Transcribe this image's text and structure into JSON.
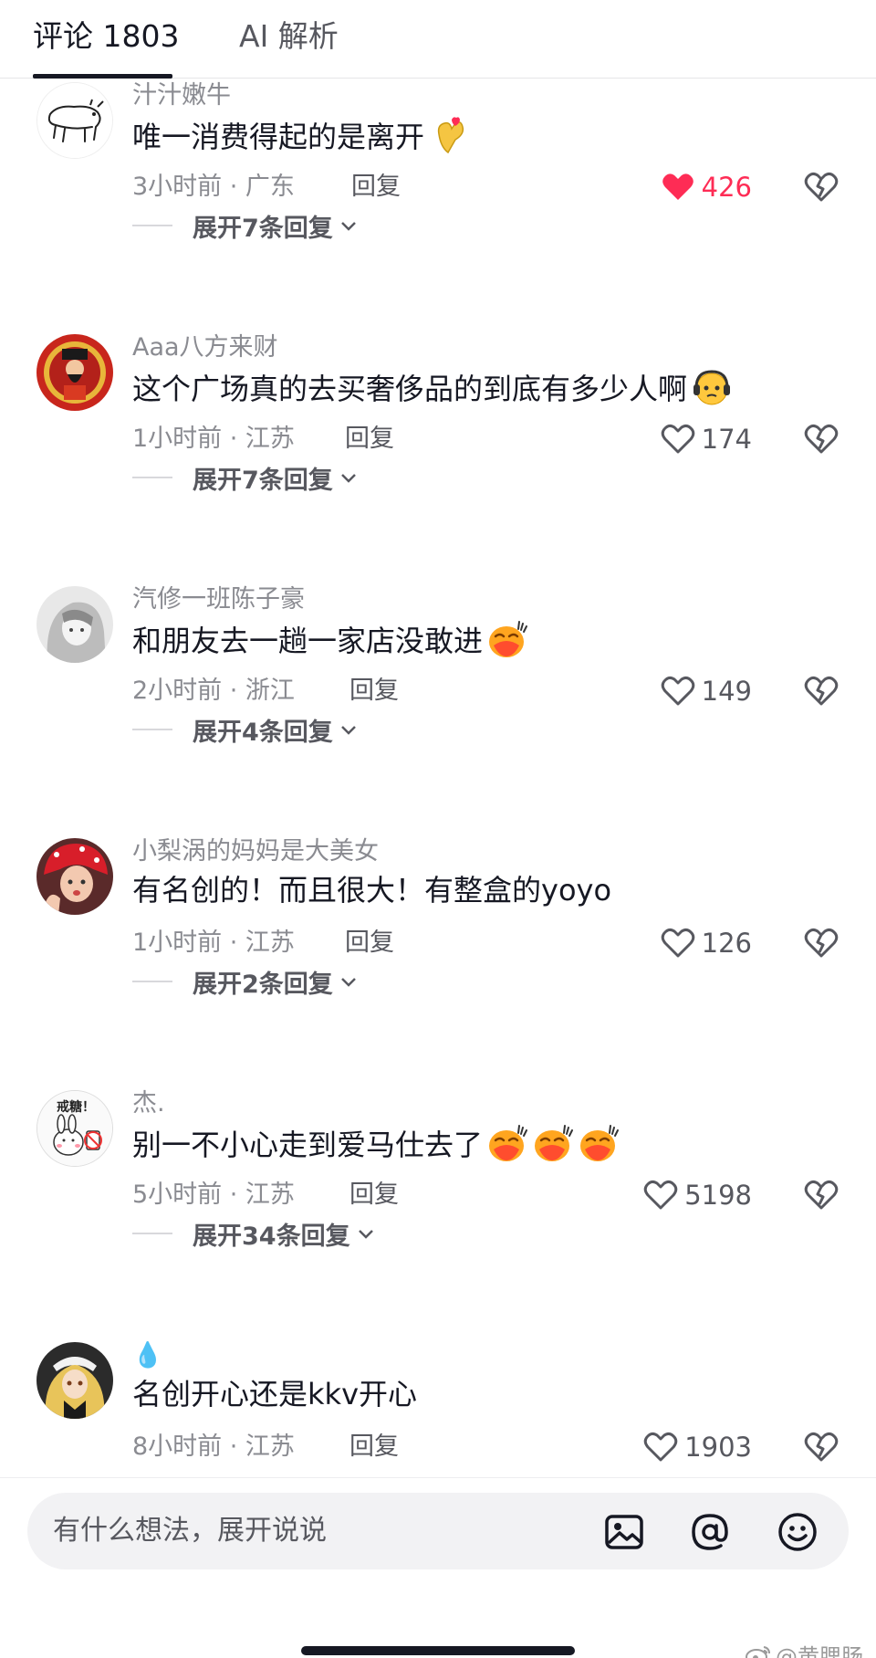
{
  "tabs": {
    "comments": "评论 1803",
    "ai": "AI 解析"
  },
  "reply_label": "回复",
  "comments": [
    {
      "username": "汁汁嫩牛",
      "text": "唯一消费得起的是离开",
      "emoji": [
        "finger-heart-emoji"
      ],
      "time_location": "3小时前 · 广东",
      "likes": "426",
      "liked": true,
      "expand": "展开7条回复"
    },
    {
      "username": "Aaa八方来财",
      "text": "这个广场真的去买奢侈品的到底有多少人啊",
      "emoji": [
        "headphones-face-emoji"
      ],
      "time_location": "1小时前 · 江苏",
      "likes": "174",
      "liked": false,
      "expand": "展开7条回复"
    },
    {
      "username": "汽修一班陈子豪",
      "text": "和朋友去一趟一家店没敢进",
      "emoji": [
        "blushing-face-emoji"
      ],
      "time_location": "2小时前 · 浙江",
      "likes": "149",
      "liked": false,
      "expand": "展开4条回复"
    },
    {
      "username": "小梨涡的妈妈是大美女",
      "text": "有名创的！而且很大！有整盒的yoyo",
      "emoji": [],
      "time_location": "1小时前 · 江苏",
      "likes": "126",
      "liked": false,
      "expand": "展开2条回复"
    },
    {
      "username": "杰.",
      "text": "别一不小心走到爱马仕去了",
      "emoji": [
        "blushing-face-emoji",
        "blushing-face-emoji",
        "blushing-face-emoji"
      ],
      "time_location": "5小时前 · 江苏",
      "likes": "5198",
      "liked": false,
      "expand": "展开34条回复"
    },
    {
      "username": "💧",
      "text": "名创开心还是kkv开心",
      "emoji": [],
      "time_location": "8小时前 · 江苏",
      "likes": "1903",
      "liked": false,
      "expand": ""
    }
  ],
  "avatar_sticker_text": "戒糖！",
  "input": {
    "placeholder": "有什么想法，展开说说"
  },
  "watermark": "@黄腮肠",
  "colors": {
    "like_active": "#fe2c55",
    "text_primary": "#161823",
    "text_secondary": "#8a8b91"
  }
}
